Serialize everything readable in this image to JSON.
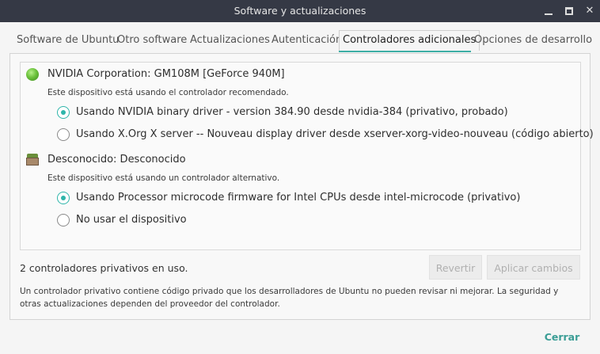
{
  "window": {
    "title": "Software y actualizaciones"
  },
  "tabs": [
    {
      "label": "Software de Ubuntu"
    },
    {
      "label": "Otro software"
    },
    {
      "label": "Actualizaciones"
    },
    {
      "label": "Autenticación"
    },
    {
      "label": "Controladores adicionales"
    },
    {
      "label": "Opciones de desarrollo"
    }
  ],
  "devices": [
    {
      "name": "NVIDIA Corporation: GM108M [GeForce 940M]",
      "note": "Este dispositivo está usando el controlador recomendado.",
      "icon": "green-led-icon",
      "options": [
        {
          "label": "Usando NVIDIA binary driver - version 384.90 desde nvidia-384 (privativo, probado)",
          "checked": true
        },
        {
          "label": "Usando X.Org X server -- Nouveau display driver desde xserver-xorg-video-nouveau (código abierto)",
          "checked": false
        }
      ]
    },
    {
      "name": "Desconocido: Desconocido",
      "note": "Este dispositivo está usando un controlador alternativo.",
      "icon": "chip-icon",
      "options": [
        {
          "label": "Usando Processor microcode firmware for Intel CPUs desde intel-microcode (privativo)",
          "checked": true
        },
        {
          "label": "No usar el dispositivo",
          "checked": false
        }
      ]
    }
  ],
  "status": "2 controladores privativos en uso.",
  "buttons": {
    "revert": "Revertir",
    "apply": "Aplicar cambios",
    "close": "Cerrar"
  },
  "info": "Un controlador privativo contiene código privado que los desarrolladores de Ubuntu no pueden revisar ni mejorar. La seguridad y otras actualizaciones dependen del proveedor del controlador.",
  "colors": {
    "accent": "#3daea5",
    "titlebar": "#353945"
  }
}
